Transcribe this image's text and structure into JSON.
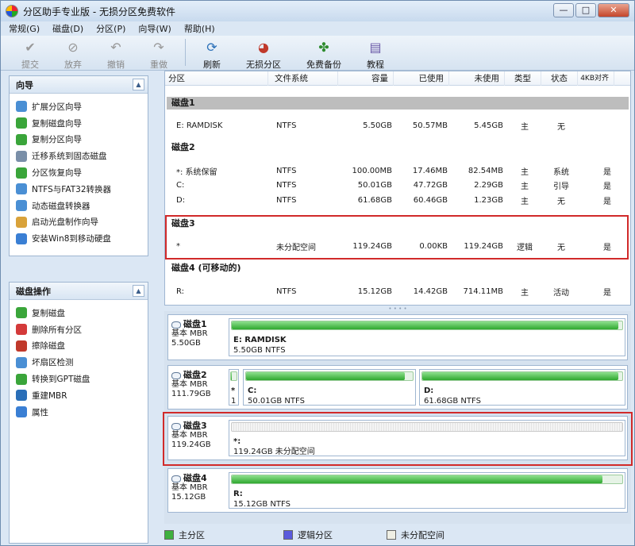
{
  "window": {
    "title": "分区助手专业版 - 无损分区免费软件",
    "buttons": [
      "—",
      "□",
      "✕"
    ]
  },
  "menu": [
    "常规(G)",
    "磁盘(D)",
    "分区(P)",
    "向导(W)",
    "帮助(H)"
  ],
  "toolbar": [
    {
      "label": "提交",
      "icon": "check-icon",
      "enabled": false
    },
    {
      "label": "放弃",
      "icon": "discard-icon",
      "enabled": false
    },
    {
      "label": "撤销",
      "icon": "undo-icon",
      "enabled": false
    },
    {
      "label": "重做",
      "icon": "redo-icon",
      "enabled": false
    },
    {
      "label": "刷新",
      "icon": "refresh-icon",
      "enabled": true
    },
    {
      "label": "无损分区",
      "icon": "partition-icon",
      "enabled": true
    },
    {
      "label": "免费备份",
      "icon": "backup-icon",
      "enabled": true
    },
    {
      "label": "教程",
      "icon": "tutorial-icon",
      "enabled": true
    }
  ],
  "wizard_panel": {
    "title": "向导",
    "items": [
      "扩展分区向导",
      "复制磁盘向导",
      "复制分区向导",
      "迁移系统到固态磁盘",
      "分区恢复向导",
      "NTFS与FAT32转换器",
      "动态磁盘转换器",
      "启动光盘制作向导",
      "安装Win8到移动硬盘"
    ]
  },
  "disk_ops_panel": {
    "title": "磁盘操作",
    "items": [
      "复制磁盘",
      "删除所有分区",
      "擦除磁盘",
      "坏扇区检测",
      "转换到GPT磁盘",
      "重建MBR",
      "属性"
    ]
  },
  "table": {
    "columns": [
      "分区",
      "文件系统",
      "容量",
      "已使用",
      "未使用",
      "类型",
      "状态",
      "4KB对齐"
    ],
    "disks": [
      {
        "name": "磁盘1",
        "rows": [
          [
            "E: RAMDISK",
            "NTFS",
            "5.50GB",
            "50.57MB",
            "5.45GB",
            "主",
            "无",
            ""
          ]
        ]
      },
      {
        "name": "磁盘2",
        "rows": [
          [
            "*: 系统保留",
            "NTFS",
            "100.00MB",
            "17.46MB",
            "82.54MB",
            "主",
            "系统",
            "是"
          ],
          [
            "C:",
            "NTFS",
            "50.01GB",
            "47.72GB",
            "2.29GB",
            "主",
            "引导",
            "是"
          ],
          [
            "D:",
            "NTFS",
            "61.68GB",
            "60.46GB",
            "1.23GB",
            "主",
            "无",
            "是"
          ]
        ]
      },
      {
        "name": "磁盘3",
        "rows": [
          [
            "*",
            "未分配空间",
            "119.24GB",
            "0.00KB",
            "119.24GB",
            "逻辑",
            "无",
            "是"
          ]
        ]
      },
      {
        "name": "磁盘4 (可移动的)",
        "rows": [
          [
            "R:",
            "NTFS",
            "15.12GB",
            "14.42GB",
            "714.11MB",
            "主",
            "活动",
            "是"
          ]
        ]
      }
    ]
  },
  "disk_map": [
    {
      "name": "磁盘1",
      "type": "基本 MBR",
      "size": "5.50GB",
      "parts": [
        {
          "label": "E: RAMDISK",
          "info": "5.50GB NTFS",
          "kind": "primary",
          "used": 0.99
        }
      ]
    },
    {
      "name": "磁盘2",
      "type": "基本 MBR",
      "size": "111.79GB",
      "parts": [
        {
          "label": "*",
          "info": "1",
          "kind": "primary",
          "used": 0.2
        },
        {
          "label": "C:",
          "info": "50.01GB NTFS",
          "kind": "primary",
          "used": 0.95
        },
        {
          "label": "D:",
          "info": "61.68GB NTFS",
          "kind": "primary",
          "used": 0.98
        }
      ]
    },
    {
      "name": "磁盘3",
      "type": "基本 MBR",
      "size": "119.24GB",
      "parts": [
        {
          "label": "*:",
          "info": "119.24GB 未分配空间",
          "kind": "unallocated",
          "used": 0
        }
      ]
    },
    {
      "name": "磁盘4",
      "type": "基本 MBR",
      "size": "15.12GB",
      "parts": [
        {
          "label": "R:",
          "info": "15.12GB NTFS",
          "kind": "primary",
          "used": 0.95
        }
      ]
    }
  ],
  "legend": [
    {
      "label": "主分区",
      "color": "#3fb03f"
    },
    {
      "label": "逻辑分区",
      "color": "#5a5adc"
    },
    {
      "label": "未分配空间",
      "color": "#efefe4"
    }
  ],
  "colors": {
    "highlight": "#d12a2a",
    "primary_bar": "#2fa82f"
  }
}
